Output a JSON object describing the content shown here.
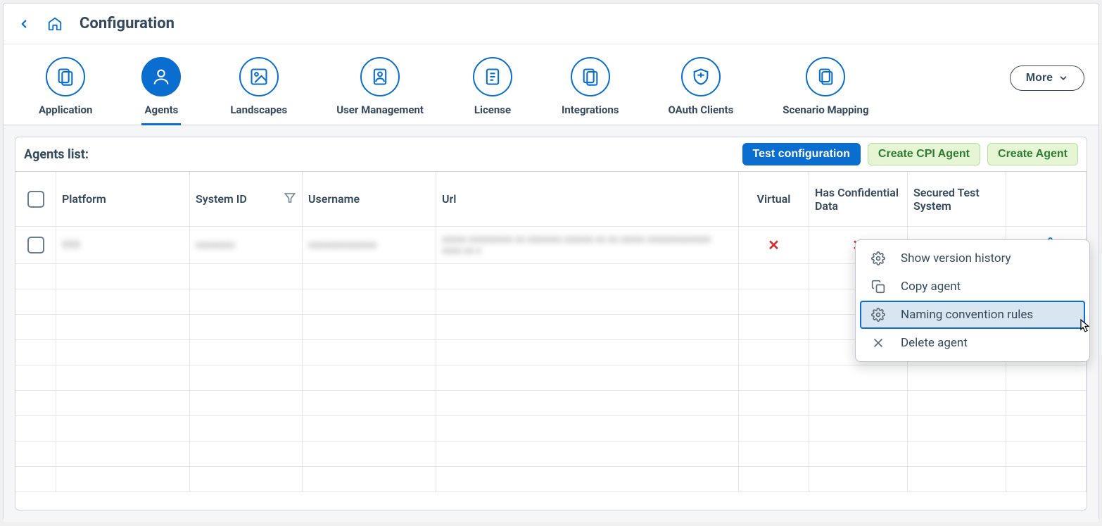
{
  "breadcrumb": {
    "title": "Configuration"
  },
  "tabs": {
    "items": [
      {
        "label": "Application"
      },
      {
        "label": "Agents"
      },
      {
        "label": "Landscapes"
      },
      {
        "label": "User Management"
      },
      {
        "label": "License"
      },
      {
        "label": "Integrations"
      },
      {
        "label": "OAuth Clients"
      },
      {
        "label": "Scenario Mapping"
      }
    ],
    "more_label": "More"
  },
  "panel": {
    "title": "Agents list:",
    "actions": {
      "test_config": "Test configuration",
      "create_cpi": "Create CPI Agent",
      "create_agent": "Create Agent"
    }
  },
  "table": {
    "headers": {
      "platform": "Platform",
      "system_id": "System ID",
      "username": "Username",
      "url": "Url",
      "virtual": "Virtual",
      "confidential": "Has Confidential Data",
      "secured": "Secured Test System"
    },
    "rows": [
      {
        "platform": "XXX",
        "system_id": "xxxxxxxx",
        "username": "xxxxxxxxxxxxxx",
        "url": "xxxxx xxxxxxxxx xx xxxxxxx xxxxxx xx xx xxxxx xxxxxxxxxxxxx xxxx xx x",
        "virtual": "✕",
        "confidential": "✕",
        "secured": "✕"
      }
    ]
  },
  "context_menu": {
    "items": [
      {
        "label": "Show version history"
      },
      {
        "label": "Copy agent"
      },
      {
        "label": "Naming convention rules"
      },
      {
        "label": "Delete agent"
      }
    ]
  }
}
